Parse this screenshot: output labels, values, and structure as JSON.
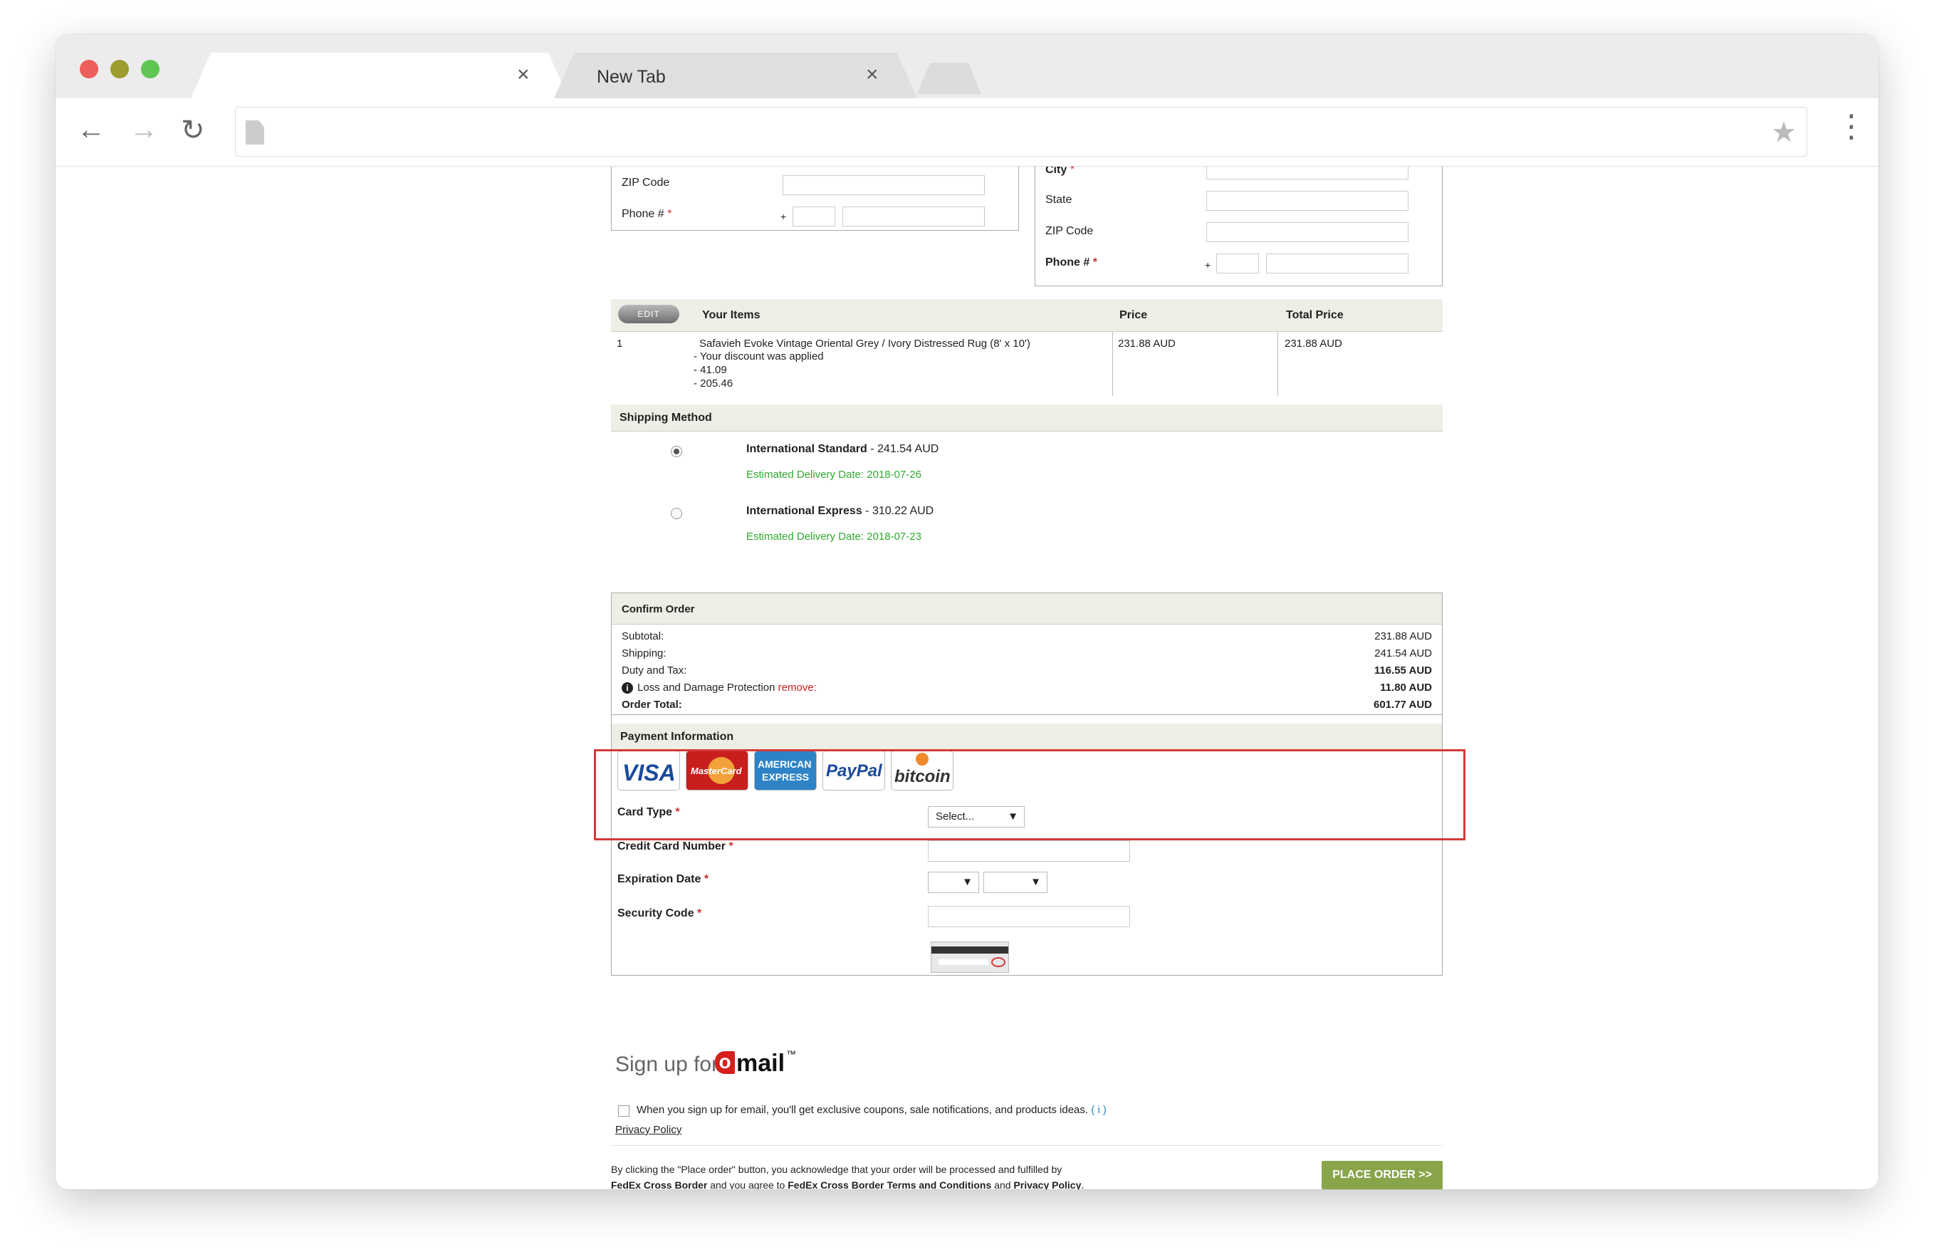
{
  "browser": {
    "active_tab_title": "",
    "inactive_tab_title": "New Tab",
    "close_glyph": "×",
    "address": ""
  },
  "left_address": {
    "zip_label": "ZIP Code",
    "phone_label": "Phone #",
    "required_mark": "*",
    "plus_sign": "+"
  },
  "right_address": {
    "city_label": "City",
    "state_label": "State",
    "zip_label": "ZIP Code",
    "phone_label": "Phone #",
    "required_mark": "*",
    "plus_sign": "+"
  },
  "items_table": {
    "edit_label": "EDIT",
    "headers": [
      "Your Items",
      "Price",
      "Total Price"
    ],
    "rows": [
      {
        "qty": "1",
        "name": "Safavieh Evoke Vintage Oriental Grey / Ivory Distressed Rug (8' x 10')",
        "details": [
          "- Your discount was applied",
          "- 41.09",
          "- 205.46"
        ],
        "price": "231.88 AUD",
        "total": "231.88 AUD"
      }
    ]
  },
  "shipping": {
    "title": "Shipping Method",
    "options": [
      {
        "name": "International Standard",
        "price": " - 241.54 AUD",
        "delivery": "Estimated Delivery Date: 2018-07-26",
        "selected": true
      },
      {
        "name": "International Express",
        "price": " - 310.22 AUD",
        "delivery": "Estimated Delivery Date: 2018-07-23",
        "selected": false
      }
    ]
  },
  "confirm": {
    "title": "Confirm Order",
    "rows": [
      {
        "label": "Subtotal:",
        "value": "231.88 AUD"
      },
      {
        "label": "Shipping:",
        "value": "241.54 AUD"
      },
      {
        "label": "Duty and Tax:",
        "value": "116.55 AUD"
      },
      {
        "label": "Loss and Damage Protection",
        "extra": "remove:",
        "value": "11.80 AUD"
      },
      {
        "label": "Order Total:",
        "value": "601.77 AUD"
      }
    ],
    "info_glyph": "i"
  },
  "payment": {
    "title": "Payment Information",
    "cards": [
      "VISA",
      "MasterCard",
      "AMERICAN",
      "EXPRESS",
      "PayPal",
      "bitcoin"
    ],
    "card_type_label": "Card Type",
    "card_type_value": "Select...",
    "card_number_label": "Credit Card Number",
    "expiration_label": "Expiration Date",
    "security_label": "Security Code",
    "required_mark": "*",
    "caret": "▼"
  },
  "signup": {
    "prefix": "Sign up for",
    "brand_o": "o",
    "brand_mail": "mail",
    "tm": "™",
    "checkbox_text": "When you sign up for email, you'll get exclusive coupons, sale notifications, and products ideas.",
    "info": "( i )",
    "privacy": "Privacy Policy"
  },
  "footer": {
    "line1": "By clicking the \"Place order\" button, you acknowledge that your order will be processed and fulfilled by",
    "fedex": "FedEx Cross Border",
    "mid": " and you agree to ",
    "terms": "FedEx Cross Border Terms and Conditions",
    "and": " and ",
    "privacy": "Privacy Policy",
    "period": ".",
    "place_order": "PLACE ORDER >>"
  }
}
